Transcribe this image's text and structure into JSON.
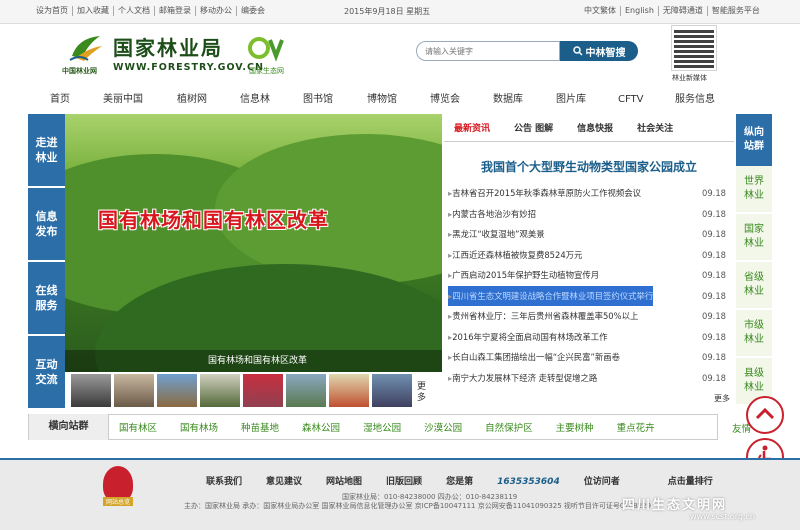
{
  "topbar": {
    "links": [
      "设为首页",
      "加入收藏",
      "个人文档",
      "邮箱登录",
      "移动办公",
      "编委会"
    ],
    "date": "2015年9月18日 星期五",
    "right_links": [
      "中文繁体",
      "English",
      "无障碍通道",
      "智能服务平台"
    ]
  },
  "header": {
    "logo_title": "国家林业局",
    "logo_url": "WWW.FORESTRY.GOV.CN",
    "logo_sub": "中国林业网",
    "eco_sub": "国家生态网",
    "search_placeholder": "请输入关键字",
    "search_button": "中林智搜",
    "qr_label": "林业新媒体"
  },
  "nav": [
    "首页",
    "美丽中国",
    "植树网",
    "信息林",
    "图书馆",
    "博物馆",
    "博览会",
    "数据库",
    "图片库",
    "CFTV",
    "服务信息"
  ],
  "sidenav": [
    "走进林业",
    "信息发布",
    "在线服务",
    "互动交流"
  ],
  "hero": {
    "banner": "国有林场和国有林区改革",
    "caption": "国有林场和国有林区改革"
  },
  "thumbs_more": "更多",
  "news": {
    "tabs": [
      "最新资讯",
      "公告  图解",
      "信息快报",
      "社会关注"
    ],
    "headline": "我国首个大型野生动物类型国家公园成立",
    "items": [
      {
        "title": "吉林省召开2015年秋季森林草原防火工作视频会议",
        "date": "09.18"
      },
      {
        "title": "内蒙古各地治沙有妙招",
        "date": "09.18"
      },
      {
        "title": "黑龙江“收复湿地”观美景",
        "date": "09.18"
      },
      {
        "title": "江西近还森林植被恢复费8524万元",
        "date": "09.18"
      },
      {
        "title": "广西启动2015年保护野生动植物宣传月",
        "date": "09.18"
      },
      {
        "title": "四川省生态文明建设战略合作暨林业项目签约仪式举行",
        "date": "09.18"
      },
      {
        "title": "贵州省林业厅：三年后贵州省森林覆盖率50%以上",
        "date": "09.18"
      },
      {
        "title": "2016年宁夏将全面启动国有林场改革工作",
        "date": "09.18"
      },
      {
        "title": "长白山森工集团描绘出一幅“企兴民富”新画卷",
        "date": "09.18"
      },
      {
        "title": "南宁大力发展林下经济 走转型促增之路",
        "date": "09.18"
      }
    ],
    "more": "更多"
  },
  "vertical": {
    "head": "纵向站群",
    "items": [
      "世界林业",
      "国家林业",
      "省级林业",
      "市级林业",
      "县级林业"
    ]
  },
  "horizontal": {
    "head": "横向站群",
    "items": [
      "国有林区",
      "国有林场",
      "种苗基地",
      "森林公园",
      "湿地公园",
      "沙漠公园",
      "自然保护区",
      "主要树种",
      "重点花卉"
    ],
    "clip": "友情"
  },
  "footer": {
    "links": [
      "联系我们",
      "意见建议",
      "网站地图",
      "旧版回顾"
    ],
    "visit_prefix": "您是第",
    "visit_count": "1635353604",
    "visit_suffix": "位访问者",
    "ranking": "点击量排行",
    "line1": "国家林业局：010-84238000  四办公：010-84238119",
    "line2": "主办：国家林业局  承办：国家林业局办公室  国家林业局信息化管理办公室  京ICP备10047111  京公网安备11041090325  视听节目许可证号0108229",
    "emblem_label": "网站总览",
    "watermark": "四川生态文明网",
    "watermark_url": "www.scst.org.cn"
  },
  "colors": {
    "accent_blue": "#2b6ea8",
    "accent_red": "#d8161e",
    "green_link": "#3a8a1e"
  }
}
